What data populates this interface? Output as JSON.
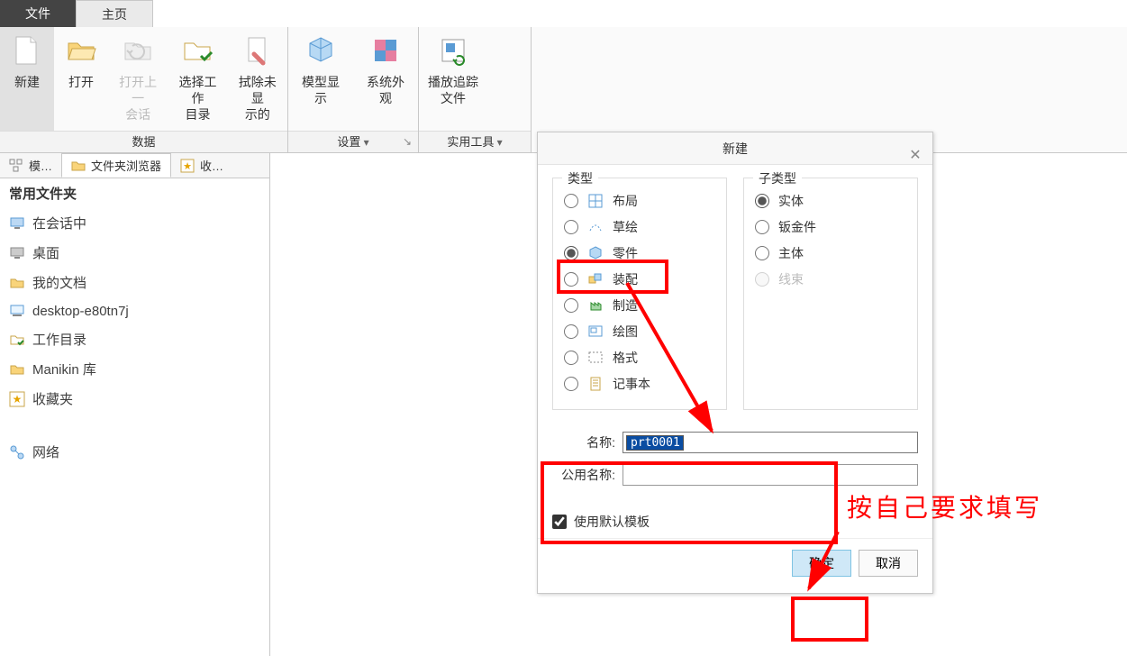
{
  "tabs": {
    "file": "文件",
    "home": "主页"
  },
  "ribbon": {
    "newbuild": "新建",
    "open": "打开",
    "open_last": "打开上一\n会话",
    "select_workdir": "选择工作\n目录",
    "wipe_unshown": "拭除未显\n示的",
    "model_display": "模型显示",
    "sys_appearance": "系统外观",
    "play_trace": "播放追踪\n文件",
    "group_data": "数据",
    "group_settings": "设置",
    "group_utils": "实用工具"
  },
  "side_tabs": {
    "model": "模…",
    "folder_browser": "文件夹浏览器",
    "favorites": "收…"
  },
  "sidebar": {
    "header": "常用文件夹",
    "in_session": "在会话中",
    "desktop": "桌面",
    "my_docs": "我的文档",
    "hostname": "desktop-e80tn7j",
    "workdir": "工作目录",
    "manikin": "Manikin 库",
    "fav": "收藏夹",
    "network": "网络"
  },
  "dialog": {
    "title": "新建",
    "type_legend": "类型",
    "subtype_legend": "子类型",
    "types": {
      "layout": "布局",
      "sketch": "草绘",
      "part": "零件",
      "assembly": "装配",
      "mfg": "制造",
      "drawing": "绘图",
      "format": "格式",
      "notebook": "记事本"
    },
    "subtypes": {
      "solid": "实体",
      "sheetmetal": "钣金件",
      "body": "主体",
      "harness": "线束"
    },
    "name_label": "名称:",
    "common_name_label": "公用名称:",
    "name_value": "prt0001",
    "common_name_value": "",
    "use_default_template": "使用默认模板",
    "ok": "确定",
    "cancel": "取消"
  },
  "annotations": {
    "main": "按自己要求填写"
  }
}
